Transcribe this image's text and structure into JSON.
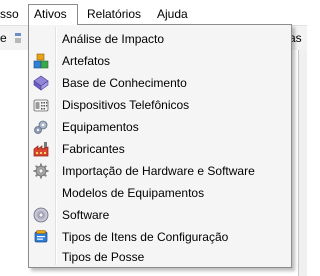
{
  "menubar": {
    "items": [
      {
        "label": "sso"
      },
      {
        "label": "Ativos"
      },
      {
        "label": "Relatórios"
      },
      {
        "label": "Ajuda"
      }
    ]
  },
  "toolbar": {
    "left_text": "e",
    "right_text": "as"
  },
  "ativos_menu": {
    "items": [
      {
        "label": "Análise de Impacto",
        "icon": "none"
      },
      {
        "label": "Artefatos",
        "icon": "artifacts-icon"
      },
      {
        "label": "Base de Conhecimento",
        "icon": "knowledge-base-icon"
      },
      {
        "label": "Dispositivos Telefônicos",
        "icon": "telephone-icon"
      },
      {
        "label": "Equipamentos",
        "icon": "gears-icon"
      },
      {
        "label": "Fabricantes",
        "icon": "factory-icon"
      },
      {
        "label": "Importação de Hardware e Software",
        "icon": "gear-icon"
      },
      {
        "label": "Modelos de Equipamentos",
        "icon": "none"
      },
      {
        "label": "Software",
        "icon": "disc-icon"
      },
      {
        "label": "Tipos de Itens de Configuração",
        "icon": "config-items-icon"
      },
      {
        "label": "Tipos de Posse",
        "icon": "none"
      }
    ]
  }
}
